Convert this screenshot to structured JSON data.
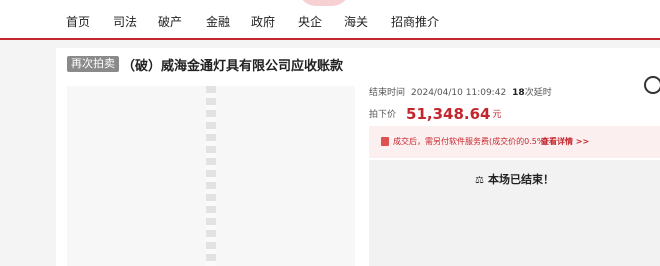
{
  "nav": {
    "items": [
      "首页",
      "司法",
      "破产",
      "金融",
      "政府",
      "央企",
      "海关",
      "招商推介"
    ]
  },
  "auction": {
    "tag": "再次拍卖",
    "title": "（破）威海金通灯具有限公司应收账款",
    "end_time_label": "结束时间",
    "end_time_value": "2024/04/10 11:09:42",
    "delay_count": "18",
    "delay_label": "次延时",
    "price_label": "拍下价",
    "price_value": "51,348.64",
    "price_unit": "元",
    "notice_text": "成交后，需另付软件服务费(成交价的0.5%)",
    "notice_link": "查看详情 >>",
    "ended_icon": "⚖",
    "ended_text": "本场已结束！"
  },
  "colors": {
    "accent": "#c4262e",
    "notice_bg": "#fcefef",
    "tag_bg": "#8a8a8a"
  },
  "icons": [
    "gavel-icon",
    "hammer-timer-icon",
    "lock-notice-icon"
  ]
}
